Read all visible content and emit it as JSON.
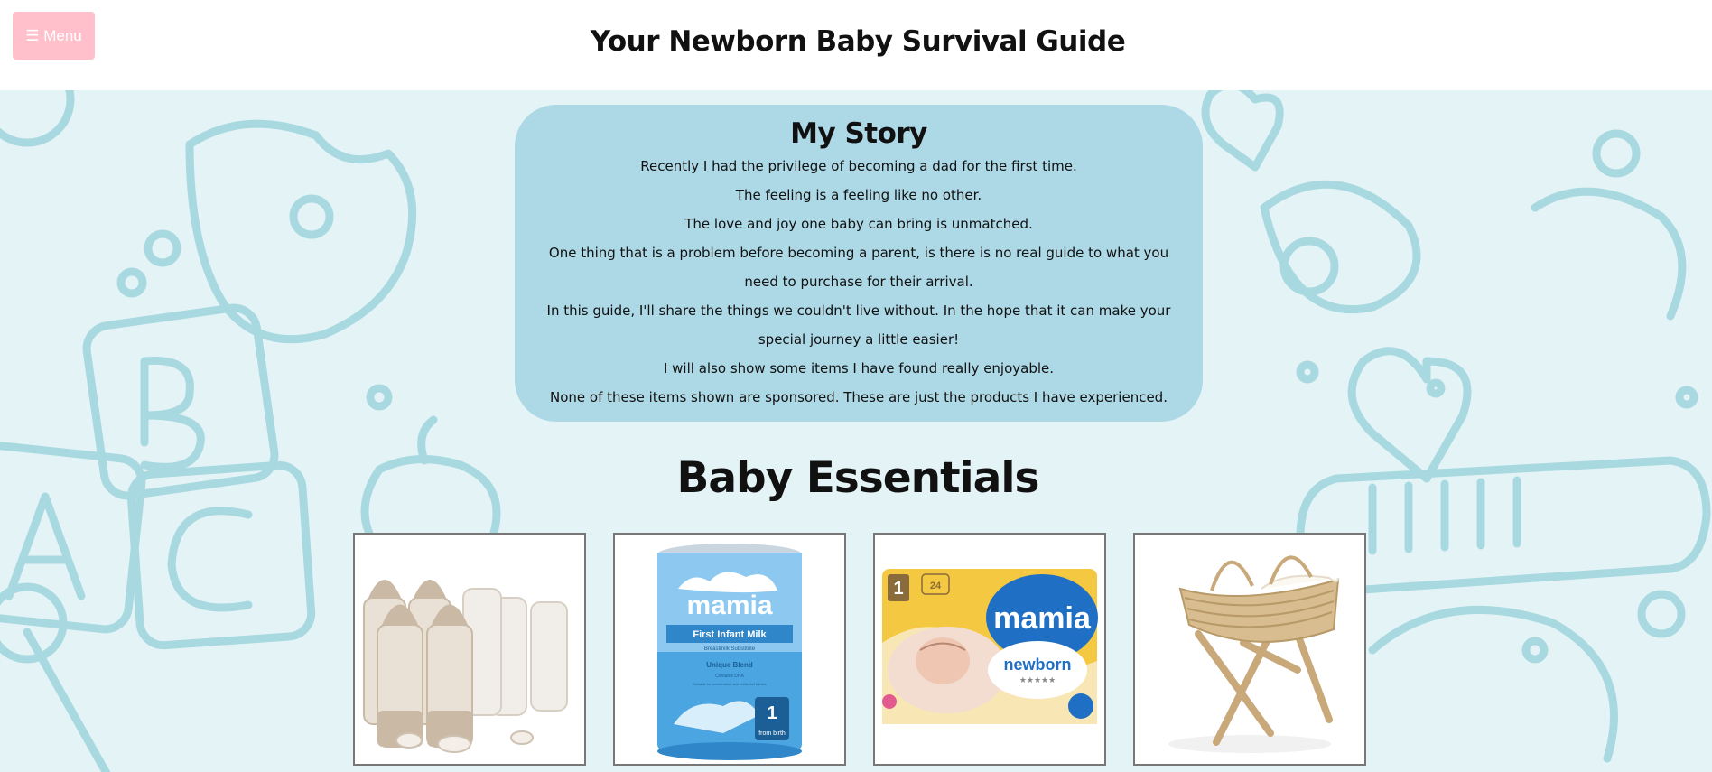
{
  "header": {
    "menu_label": "☰ Menu",
    "title": "Your Newborn Baby Survival Guide"
  },
  "story": {
    "title": "My Story",
    "lines": [
      "Recently I had the privilege of becoming a dad for the first time.",
      "The feeling is a feeling like no other.",
      "The love and joy one baby can bring is unmatched.",
      "One thing that is a problem before becoming a parent, is there is no real guide to what you need to purchase for their arrival.",
      "In this guide, I'll share the things we couldn't live without. In the hope that it can make your special journey a little easier!",
      "I will also show some items I have found really enjoyable.",
      "None of these items shown are sponsored. These are just the products I have experienced."
    ]
  },
  "essentials": {
    "title": "Baby Essentials",
    "products": [
      {
        "icon": "baby-bottles-image"
      },
      {
        "icon": "formula-tin-image",
        "brand": "mamia",
        "product": "First Infant Milk",
        "subtitle": "Breastmilk Substitute",
        "blend": "Unique Blend",
        "note1": "Contains DHA",
        "note2": "Suitable for combination and bottle-fed babies",
        "stage": "1",
        "stage_label": "from birth"
      },
      {
        "icon": "nappies-pack-image",
        "brand": "mamia",
        "size": "1",
        "count": "24",
        "variant": "newborn",
        "stars": "★★★★★"
      },
      {
        "icon": "moses-basket-image"
      }
    ]
  },
  "colors": {
    "menu_bg": "#ffc0cb",
    "story_bg": "#add8e6",
    "pattern_bg": "#e4f4f6",
    "pattern_line": "#a9d9e0"
  }
}
